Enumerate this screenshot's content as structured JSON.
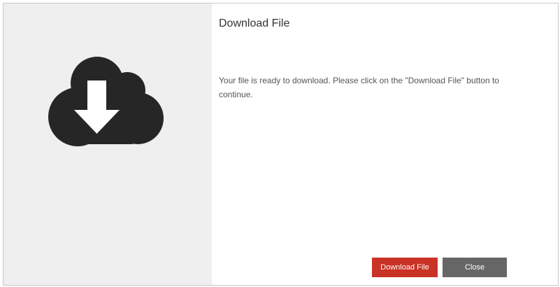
{
  "dialog": {
    "title": "Download File",
    "message": "Your file is ready to download. Please click on the \"Download File\" button to continue.",
    "icon": "cloud-download-icon",
    "buttons": {
      "download_label": "Download File",
      "close_label": "Close"
    },
    "colors": {
      "primary_button": "#c93225",
      "secondary_button": "#666666",
      "side_panel": "#efefef",
      "icon": "#262626"
    }
  }
}
